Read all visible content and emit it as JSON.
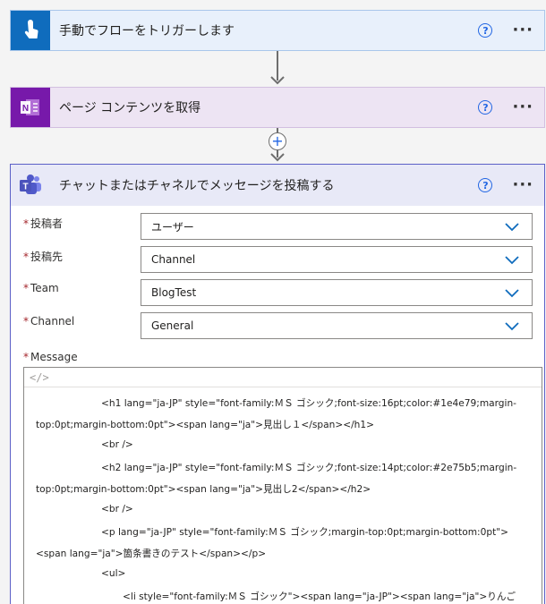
{
  "trigger": {
    "title": "手動でフローをトリガーします"
  },
  "onenote": {
    "title": "ページ コンテンツを取得"
  },
  "teams": {
    "title": "チャットまたはチャネルでメッセージを投稿する",
    "fields": [
      {
        "label": "投稿者",
        "value": "ユーザー"
      },
      {
        "label": "投稿先",
        "value": "Channel"
      },
      {
        "label": "Team",
        "value": "BlogTest"
      },
      {
        "label": "Channel",
        "value": "General"
      }
    ],
    "message_label": "Message",
    "code_toggle": "</>",
    "message_lines": [
      "<h1 lang=\"ja-JP\" style=\"font-family:ＭＳ ゴシック;font-size:16pt;color:#1e4e79;margin-",
      "top:0pt;margin-bottom:0pt\"><span lang=\"ja\">見出し１</span></h1>",
      "<br />",
      "<h2 lang=\"ja-JP\" style=\"font-family:ＭＳ ゴシック;font-size:14pt;color:#2e75b5;margin-",
      "top:0pt;margin-bottom:0pt\"><span lang=\"ja\">見出し2</span></h2>",
      "<br />",
      "<p lang=\"ja-JP\" style=\"font-family:ＭＳ ゴシック;margin-top:0pt;margin-bottom:0pt\">",
      "<span lang=\"ja\">箇条書きのテスト</span></p>",
      "<ul>",
      "<li style=\"font-family:ＭＳ ゴシック\"><span lang=\"ja-JP\"><span lang=\"ja\">りんご"
    ]
  },
  "required_mark": "*",
  "help_glyph": "?",
  "more_glyph": "···",
  "add_glyph": "+",
  "colors": {
    "trigger_accent": "#0f6cbd",
    "onenote_accent": "#7719aa",
    "teams_accent": "#5b5fc7",
    "link_blue": "#2266e3"
  }
}
